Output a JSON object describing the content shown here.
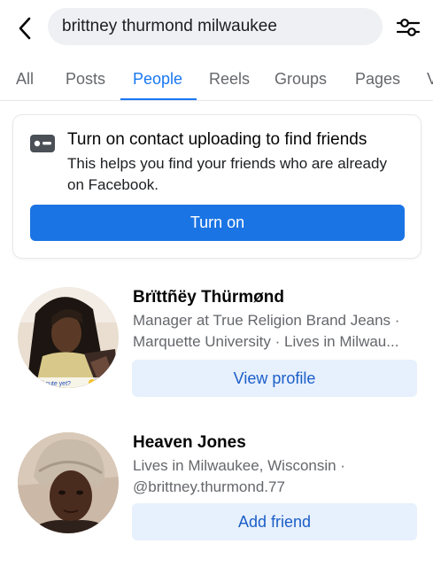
{
  "search": {
    "query": "brittney thurmond milwaukee"
  },
  "icons": {
    "back": "chevron-left-icon",
    "filter": "sliders-icon",
    "contact": "contact-card-icon"
  },
  "tabs": [
    {
      "label": "All",
      "active": false
    },
    {
      "label": "Posts",
      "active": false
    },
    {
      "label": "People",
      "active": true
    },
    {
      "label": "Reels",
      "active": false
    },
    {
      "label": "Groups",
      "active": false
    },
    {
      "label": "Pages",
      "active": false
    },
    {
      "label": "V",
      "active": false
    }
  ],
  "upload_card": {
    "title": "Turn on contact uploading to find friends",
    "description": "This helps you find your friends who are already on Facebook.",
    "button_label": "Turn on"
  },
  "results": [
    {
      "name": "Brïttñëy Thürmønd",
      "line1": "Manager at True Religion Brand Jeans ·",
      "line2": "Marquette University · Lives in Milwau...",
      "avatar_caption": "i cute yet?",
      "button_label": "View profile"
    },
    {
      "name": "Heaven Jones",
      "line1": "Lives in Milwaukee, Wisconsin ·",
      "line2": "@brittney.thurmond.77",
      "button_label": "Add friend"
    }
  ],
  "colors": {
    "accent": "#1877f2",
    "primary_button": "#1b74e4",
    "secondary_button_bg": "#e7f0fd",
    "secondary_text": "#65676b"
  }
}
